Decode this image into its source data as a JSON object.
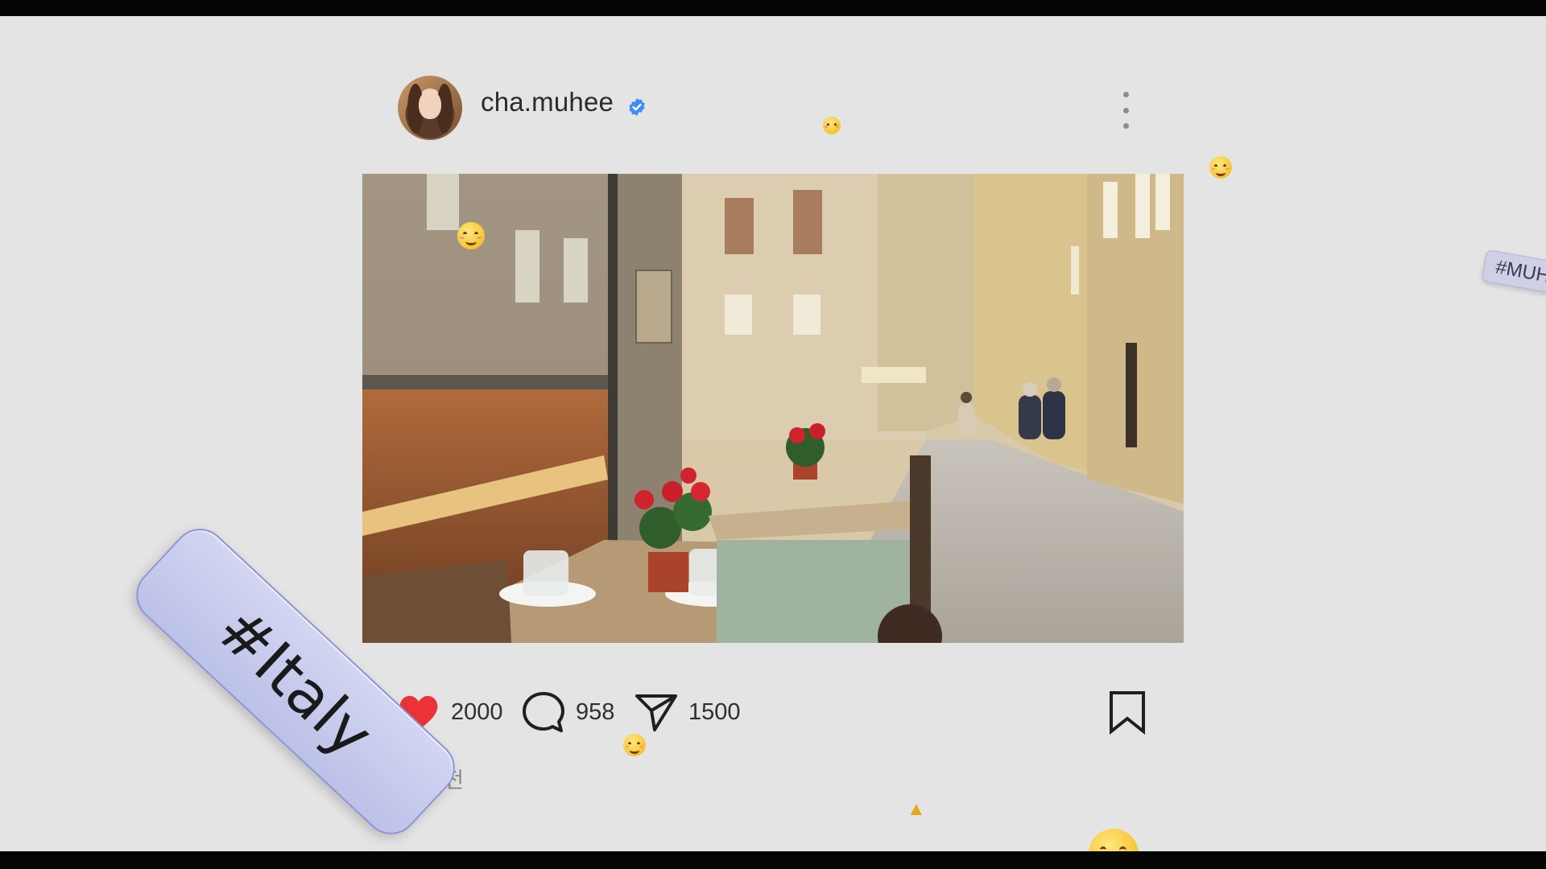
{
  "post": {
    "username": "cha.muhee",
    "timestamp": "방금 전",
    "likes": "2000",
    "comments": "958",
    "shares": "1500"
  },
  "tags": {
    "main": "#Italy",
    "side": "#MUH"
  },
  "icons": {
    "like": "heart-icon",
    "comment": "comment-icon",
    "share": "send-icon",
    "save": "bookmark-icon",
    "more": "more-vertical-icon",
    "verified": "verified-badge-icon"
  },
  "colors": {
    "background": "#e4e4e4",
    "heart": "#ec3337",
    "verified": "#3d8df5",
    "text": "#2b2b2b",
    "tag_fill": "#c9cdee"
  }
}
